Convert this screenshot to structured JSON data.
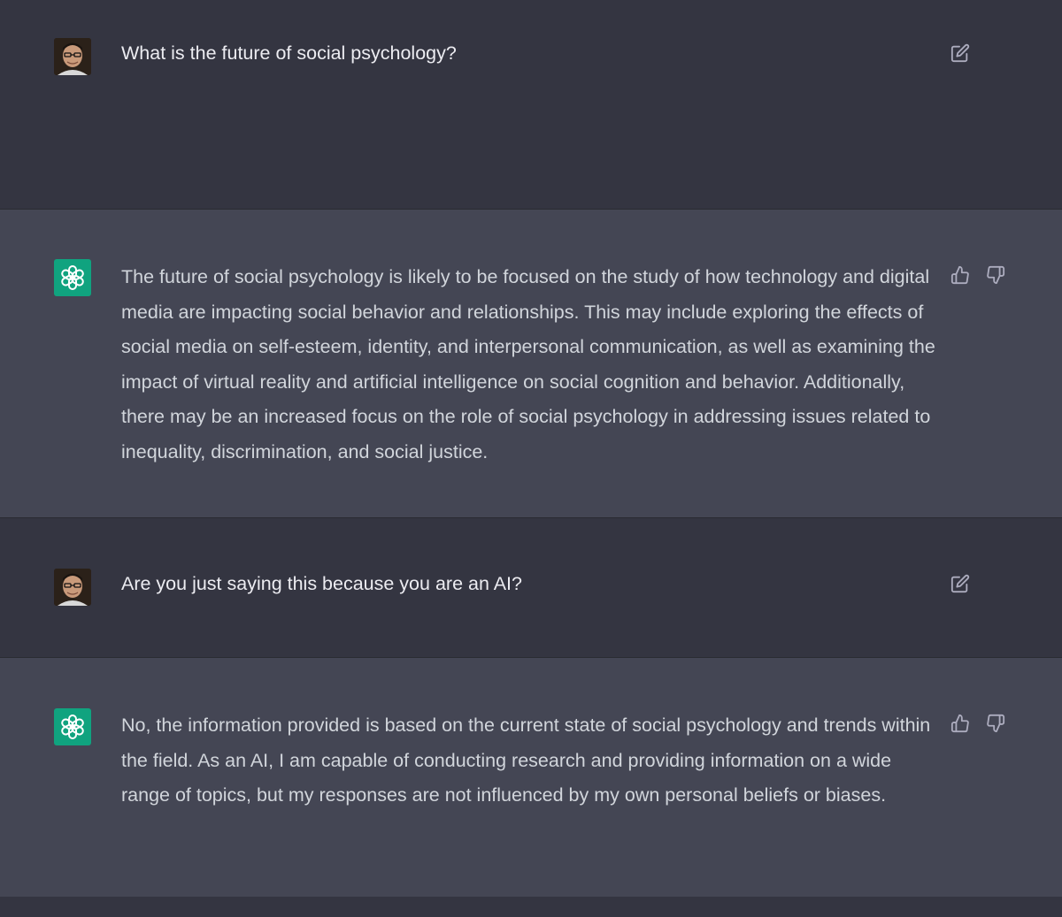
{
  "conversation": {
    "messages": [
      {
        "role": "user",
        "text": "What is the future of social psychology?",
        "edit_icon": "edit-icon"
      },
      {
        "role": "assistant",
        "text": "The future of social psychology is likely to be focused on the study of how technology and digital media are impacting social behavior and relationships. This may include exploring the effects of social media on self-esteem, identity, and interpersonal communication, as well as examining the impact of virtual reality and artificial intelligence on social cognition and behavior. Additionally, there may be an increased focus on the role of social psychology in addressing issues related to inequality, discrimination, and social justice.",
        "like_icon": "thumbs-up-icon",
        "dislike_icon": "thumbs-down-icon"
      },
      {
        "role": "user",
        "text": "Are you just saying this because you are an AI?",
        "edit_icon": "edit-icon"
      },
      {
        "role": "assistant",
        "text": "No, the information provided is based on the current state of social psychology and trends within the field. As an AI, I am capable of conducting research and providing information on a wide range of topics, but my responses are not influenced by my own personal beliefs or biases.",
        "like_icon": "thumbs-up-icon",
        "dislike_icon": "thumbs-down-icon"
      }
    ]
  },
  "colors": {
    "user_bg": "#343541",
    "assistant_bg": "#444654",
    "assistant_avatar_bg": "#10a37f",
    "user_text": "#ececf1",
    "assistant_text": "#d1d5db",
    "icon_color": "#acacbe"
  }
}
